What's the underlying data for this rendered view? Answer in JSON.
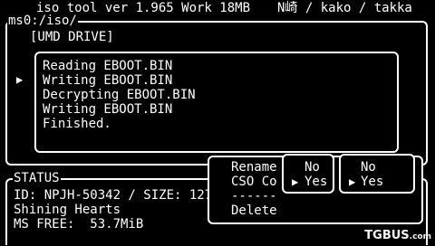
{
  "header": {
    "title": "iso_tool ver 1.965 Work 18MB",
    "authors": "N崎 / kako / takka"
  },
  "file_panel": {
    "path": "ms0:/iso/",
    "entry": "[UMD DRIVE]",
    "cursor": "▶"
  },
  "log": {
    "lines": [
      "Reading EBOOT.BIN",
      "Writing EBOOT.BIN",
      "Decrypting EBOOT.BIN",
      "Writing EBOOT.BIN",
      "Finished."
    ]
  },
  "status": {
    "label": "STATUS",
    "id_line": "ID: NPJH-50342 / SIZE: 127",
    "title": "Shining Hearts",
    "ms_free": "MS FREE:  53.7MiB"
  },
  "menu": {
    "items": [
      {
        "label": "Rename"
      },
      {
        "label": "CSO Co"
      },
      {
        "label": "------"
      },
      {
        "label": "Delete"
      }
    ],
    "options": [
      {
        "no": "No",
        "yes": "Yes",
        "cursor": "▶"
      },
      {
        "no": "No",
        "yes": "Yes",
        "cursor": "▶"
      }
    ]
  },
  "watermark": {
    "brand": "TGBUS",
    "suffix": ".com"
  },
  "colors": {
    "background": "#000000",
    "foreground": "#ffffff"
  }
}
